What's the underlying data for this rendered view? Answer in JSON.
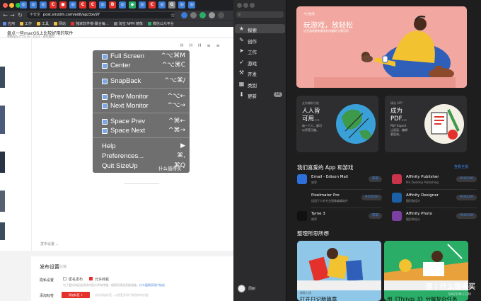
{
  "chrome": {
    "address": {
      "insecure_label": "不安全",
      "url": "post.smzdm.com/edit/apz3xv97"
    },
    "bookmarks": [
      {
        "label": "应用",
        "color": "#5b8def"
      },
      {
        "label": "工作",
        "color": "#f0c040"
      },
      {
        "label": "工具",
        "color": "#f0c040"
      },
      {
        "label": "网站",
        "color": "#f0c040"
      },
      {
        "label": "独家软件榜-聚合每...",
        "color": "#e5312b"
      },
      {
        "label": "淘宝 NPM 镜像",
        "color": "#888888"
      },
      {
        "label": "微信公众平台",
        "color": "#2aae67"
      }
    ],
    "tab_icons": [
      {
        "glyph": "◎",
        "color": "#3a7bd5"
      },
      {
        "glyph": "◎",
        "color": "#3a7bd5"
      },
      {
        "glyph": "◎",
        "color": "#3a7bd5"
      },
      {
        "glyph": "C",
        "color": "#e5312b"
      },
      {
        "glyph": "●",
        "color": "#e5312b"
      },
      {
        "glyph": "◎",
        "color": "#3a7bd5"
      },
      {
        "glyph": "C",
        "color": "#e5312b"
      },
      {
        "glyph": "C",
        "color": "#e5312b"
      },
      {
        "glyph": "◎",
        "color": "#3a7bd5"
      },
      {
        "glyph": "B",
        "color": "#e5312b"
      },
      {
        "glyph": "◎",
        "color": "#3a7bd5"
      },
      {
        "glyph": "◆",
        "color": "#2aae67"
      },
      {
        "glyph": "◎",
        "color": "#3a7bd5"
      },
      {
        "glyph": "C",
        "color": "#e5312b"
      },
      {
        "glyph": "◎",
        "color": "#3a7bd5"
      },
      {
        "glyph": "G",
        "color": "#888888"
      },
      {
        "glyph": "◎",
        "color": "#3a7bd5"
      },
      {
        "glyph": "◎",
        "color": "#3a7bd5"
      }
    ]
  },
  "editor": {
    "title": "盘点一些macOS上比较好用的软件",
    "save_status": "草稿保存于 14:39 · 约2,6 · 继续编辑",
    "format_buttons": [
      "H",
      "H",
      "H",
      "≡",
      "≡"
    ],
    "publish_settings_link": "发布设置 ⌄",
    "publish": {
      "title": "发布设置",
      "subtitle": "必填",
      "hidden_label": "隐私设置",
      "anonymous": "匿名发布",
      "original": "允许转载",
      "hint": "为了更好的促进优质内容分享和传播，值得买原创奖励措施。",
      "hint_link": "什么值得买用户协议",
      "add_tag_label": "添加标签",
      "add_tag_button": "添加标签 +",
      "add_tag_hint": "点击添加标签，以便更多用户发现你的内容"
    }
  },
  "sizeup_menu": {
    "items": [
      {
        "label": "Full Screen",
        "keys": "^⌥⌘M",
        "icon": "window-full-icon"
      },
      {
        "label": "Center",
        "keys": "^⌥⌘C",
        "icon": "window-center-icon"
      },
      {
        "label": "SnapBack",
        "keys": "^⌥⌘/",
        "icon": "snapback-icon"
      },
      {
        "label": "Prev Monitor",
        "keys": "^⌥←",
        "icon": "prev-monitor-icon"
      },
      {
        "label": "Next Monitor",
        "keys": "^⌥→",
        "icon": "next-monitor-icon"
      },
      {
        "label": "Space Prev",
        "keys": "^⌘←",
        "icon": "space-prev-icon"
      },
      {
        "label": "Space Next",
        "keys": "^⌘→",
        "icon": "space-next-icon"
      },
      {
        "label": "Help",
        "keys": "▶",
        "icon": ""
      },
      {
        "label": "Preferences...",
        "keys": "⌘,",
        "icon": ""
      },
      {
        "label": "Quit SizeUp",
        "keys": "⌘Q",
        "icon": ""
      }
    ],
    "watermark": "什么值得买"
  },
  "appstore": {
    "sidebar": [
      {
        "label": "探索",
        "icon": "star-icon",
        "glyph": "★",
        "active": true
      },
      {
        "label": "创作",
        "icon": "brush-icon",
        "glyph": "✎",
        "active": false
      },
      {
        "label": "工作",
        "icon": "paperplane-icon",
        "glyph": "➤",
        "active": false
      },
      {
        "label": "游戏",
        "icon": "rocket-icon",
        "glyph": "➶",
        "active": false
      },
      {
        "label": "开发",
        "icon": "hammer-icon",
        "glyph": "⚒",
        "active": false
      },
      {
        "label": "类别",
        "icon": "grid-icon",
        "glyph": "▦",
        "active": false
      },
      {
        "label": "更新",
        "icon": "download-icon",
        "glyph": "⬇",
        "active": false,
        "badge": "10"
      }
    ],
    "user_name": "周树",
    "hero": {
      "kicker": "今日推荐",
      "title": "玩游戏，放轻松",
      "subtitle": "这些游戏都有着轻松有趣的元素可玩"
    },
    "cards": [
      {
        "kicker": "支持辅助功能",
        "title": "人人皆\n可用...",
        "subtitle": "每一个人，都可\n以享受乐趣。"
      },
      {
        "kicker": "精选 APP",
        "title": "成为\nPDF...",
        "subtitle": "PDF Expert\n让阅读、编辑\n更容易。"
      }
    ],
    "favorites": {
      "title": "我们喜爱的 App 和游戏",
      "see_all": "查看全部",
      "apps": [
        {
          "name": "Email - Edison Mail",
          "desc": "效率",
          "price": "获取",
          "icon_color": "#2d6fdb"
        },
        {
          "name": "Affinity Publisher",
          "desc": "Pro Desktop Publishing",
          "price": "¥163.00",
          "icon_color": "#c9344a"
        },
        {
          "name": "Pixelmator Pro",
          "desc": "适用于人的专业图像编辑软件",
          "price": "¥259.00",
          "icon_color": "#1e1e1e"
        },
        {
          "name": "Affinity Designer",
          "desc": "图形和设计",
          "price": "¥163.00",
          "icon_color": "#1b5fa6"
        },
        {
          "name": "Tyme 3",
          "desc": "效率",
          "price": "获取",
          "icon_color": "#111111"
        },
        {
          "name": "Affinity Photo",
          "desc": "图形和设计",
          "price": "¥163.00",
          "icon_color": "#7b3fa1"
        }
      ]
    },
    "reflect": {
      "title": "整理所思所想",
      "stories": [
        {
          "kicker": "新陈上线",
          "title": "打开日记新篇章"
        },
        {
          "kicker": "",
          "title": "用《Things 3》分解复杂任务"
        }
      ]
    },
    "watermark_main": "值 | 什么值得买",
    "watermark_sub": "SMZDM.COM"
  }
}
